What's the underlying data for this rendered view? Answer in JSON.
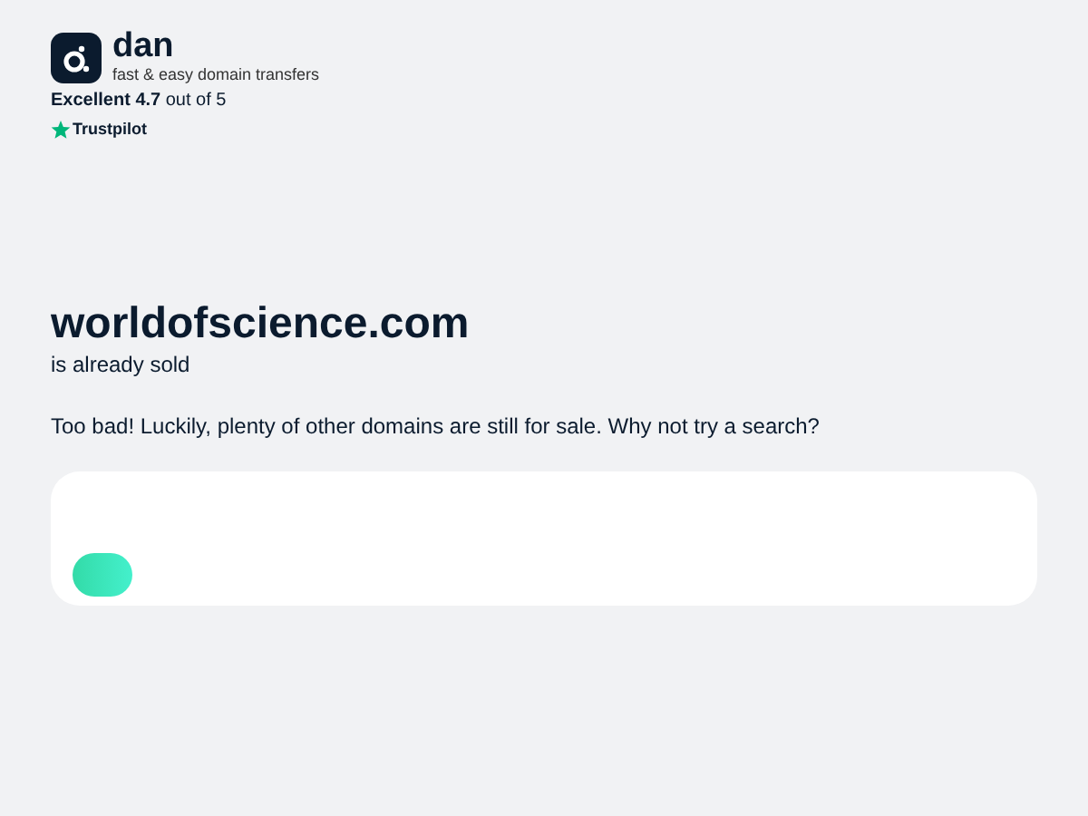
{
  "brand": {
    "name": "dan",
    "tagline": "fast & easy domain transfers"
  },
  "rating": {
    "text": "**Excellent 4.7** out of 5",
    "source": "Trustpilot"
  },
  "domain": {
    "name": "worldofscience.com",
    "status": "is already sold"
  },
  "message": "Too bad! Luckily, plenty of other domains are still for sale. Why not try a search?"
}
